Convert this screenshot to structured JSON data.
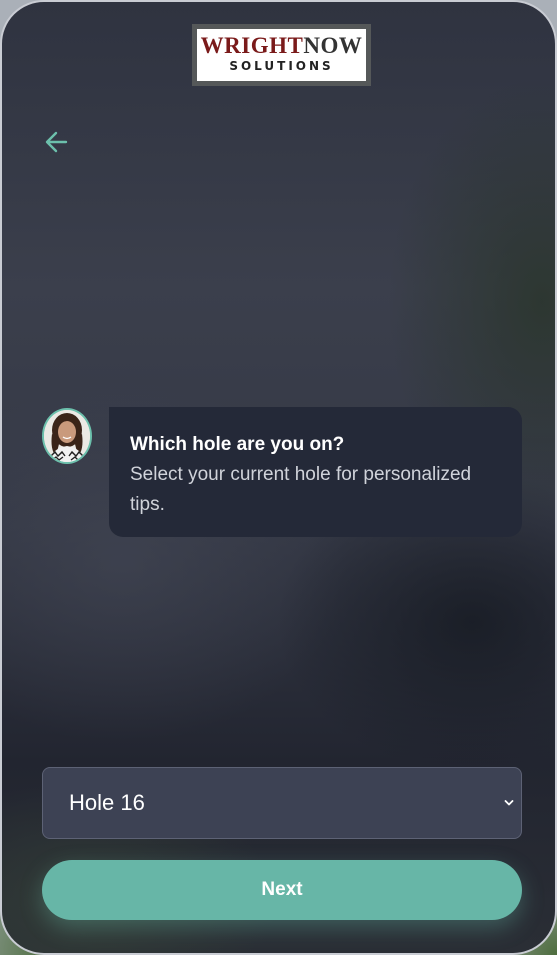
{
  "logo": {
    "line1_part1": "WRIGHT",
    "line1_part2": "NOW",
    "line2": "SOLUTIONS"
  },
  "nav": {
    "back_icon": "arrow-left-icon"
  },
  "chat": {
    "avatar": "agent-avatar",
    "title": "Which hole are you on?",
    "text": "Select your current hole for personalized tips."
  },
  "hole_select": {
    "selected": "Hole 16",
    "icon": "chevron-down-icon"
  },
  "next_button": {
    "label": "Next"
  },
  "colors": {
    "accent": "#67b6a7",
    "bubble": "#242938",
    "select_bg": "#3d4254",
    "logo_red": "#7a1a1a"
  }
}
